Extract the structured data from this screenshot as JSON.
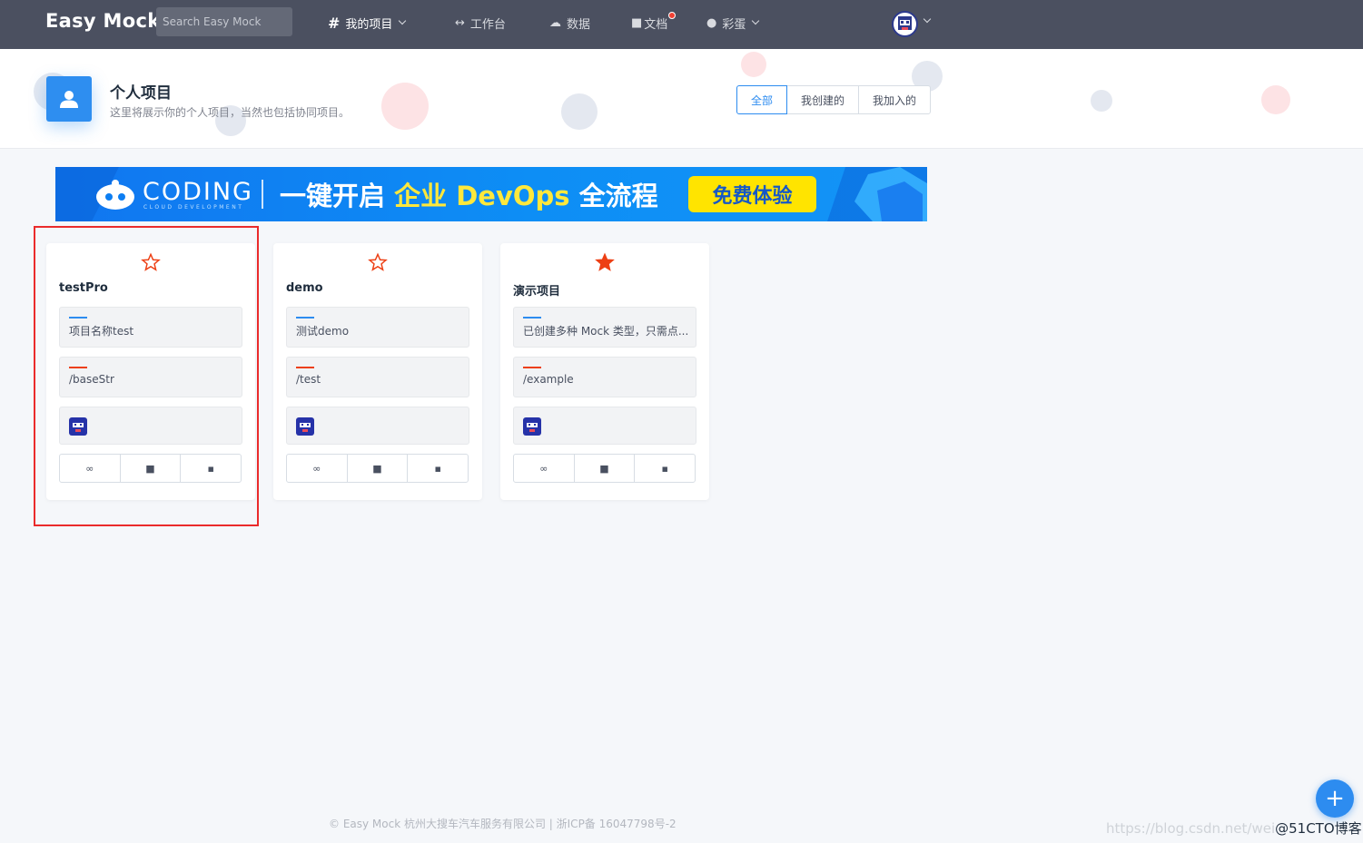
{
  "app": {
    "logo": "Easy Mock"
  },
  "search": {
    "placeholder": "Search Easy Mock"
  },
  "nav": {
    "my_projects": "我的项目",
    "workbench": "工作台",
    "data": "数据",
    "docs": "文档",
    "easter_egg": "彩蛋"
  },
  "header": {
    "title": "个人项目",
    "subtitle": "这里将展示你的个人项目，当然也包括协同项目。",
    "filters": [
      "全部",
      "我创建的",
      "我加入的"
    ],
    "active_filter": "全部"
  },
  "banner": {
    "brand": "CODING",
    "brand_sub": "CLOUD DEVELOPMENT",
    "slogan_a": "一键开启 ",
    "slogan_b": "企业 DevOps",
    "slogan_c": " 全流程",
    "cta": "免费体验"
  },
  "projects": [
    {
      "name": "testPro",
      "desc": "项目名称test",
      "base_url": "/baseStr",
      "starred": false
    },
    {
      "name": "demo",
      "desc": "测试demo",
      "base_url": "/test",
      "starred": false
    },
    {
      "name": "演示项目",
      "desc": "已创建多种 Mock 类型，只需点...",
      "base_url": "/example",
      "starred": true
    }
  ],
  "footer": {
    "text": "© Easy Mock 杭州大搜车汽车服务有限公司 | 浙ICP备 16047798号-2"
  },
  "watermark": {
    "url": "https://blog.csdn.net/wei",
    "brand": "@51CTO博客"
  },
  "colors": {
    "topbar": "#4b5060",
    "accent": "#2d8cf0",
    "star": "#ed3f14",
    "highlight": "#ea2b2b"
  }
}
